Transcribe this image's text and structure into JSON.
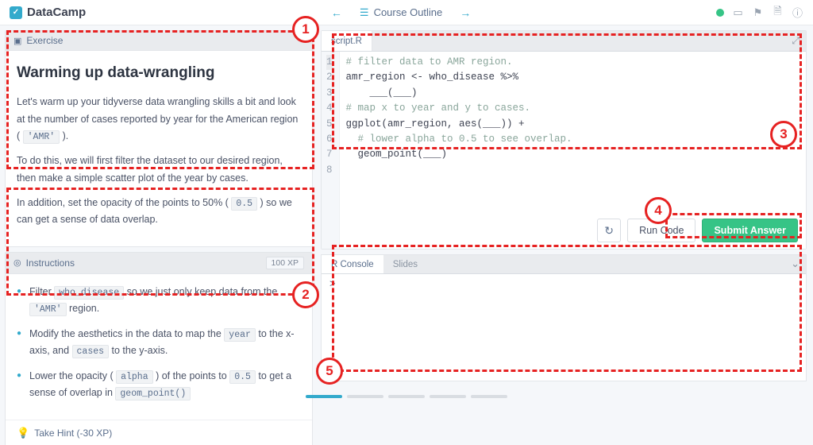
{
  "brand": "DataCamp",
  "topnav": {
    "prev": "←",
    "next": "→",
    "outline_label": "Course Outline"
  },
  "exercise": {
    "header_label": "Exercise",
    "title": "Warming up data-wrangling",
    "p1_a": "Let's warm up your tidyverse data wrangling skills a bit and look at the number of cases reported by year for the American region ( ",
    "p1_code": "'AMR'",
    "p1_b": " ).",
    "p2": "To do this, we will first filter the dataset to our desired region, then make a simple scatter plot of the year by cases.",
    "p3_a": "In addition, set the opacity of the points to 50% ( ",
    "p3_code": "0.5",
    "p3_b": " ) so we can get a sense of data overlap."
  },
  "instructions": {
    "header_label": "Instructions",
    "xp": "100 XP",
    "items": [
      {
        "pre": "Filter ",
        "c1": "who_disease",
        "mid": " so we just only keep data from the ",
        "c2": "'AMR'",
        "post": " region."
      },
      {
        "pre": "Modify the aesthetics in the data to map the ",
        "c1": "year",
        "mid": " to the x-axis, and ",
        "c2": "cases",
        "post": " to the y-axis."
      },
      {
        "pre": "Lower the opacity ( ",
        "c1": "alpha",
        "mid": " ) of the points to ",
        "c2": "0.5",
        "post": " to get a sense of overlap in ",
        "c3": "geom_point()"
      }
    ],
    "hint_label": "Take Hint (-30 XP)"
  },
  "editor": {
    "tab": "script.R",
    "lines": [
      {
        "n": "1",
        "text": "# filter data to AMR region.",
        "cls": "c-comment"
      },
      {
        "n": "2",
        "text": "amr_region <- who_disease %>%"
      },
      {
        "n": "3",
        "text": "    ___(___)"
      },
      {
        "n": "4",
        "text": ""
      },
      {
        "n": "5",
        "text": "# map x to year and y to cases.",
        "cls": "c-comment"
      },
      {
        "n": "6",
        "text": "ggplot(amr_region, aes(___)) +"
      },
      {
        "n": "7",
        "text": "  # lower alpha to 0.5 to see overlap.",
        "cls": "c-comment"
      },
      {
        "n": "8",
        "text": "  geom_point(___)"
      }
    ]
  },
  "actions": {
    "reset": "↻",
    "run": "Run Code",
    "submit": "Submit Answer"
  },
  "console": {
    "tab1": "R Console",
    "tab2": "Slides",
    "prompt": ">"
  },
  "annotations": {
    "n1": "1",
    "n2": "2",
    "n3": "3",
    "n4": "4",
    "n5": "5"
  }
}
